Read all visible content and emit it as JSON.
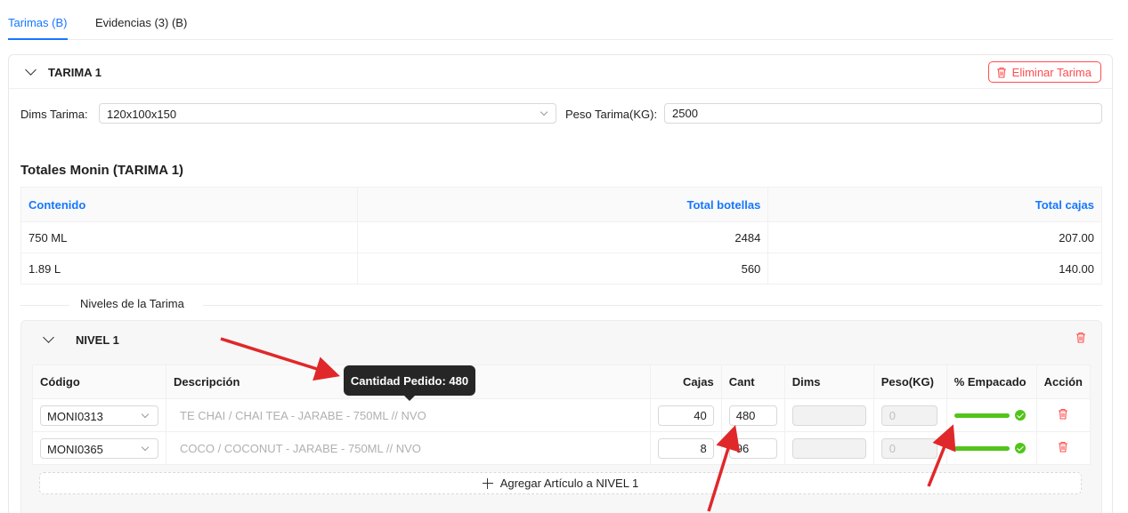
{
  "tabs": [
    {
      "label": "Tarimas (B)",
      "active": true
    },
    {
      "label": "Evidencias (3) (B)",
      "active": false
    }
  ],
  "tarima": {
    "title": "TARIMA 1",
    "delete_label": "Eliminar Tarima",
    "dims_label": "Dims Tarima",
    "dims_value": "120x100x150",
    "peso_label": "Peso Tarima(KG)",
    "peso_value": "2500"
  },
  "totales": {
    "title": "Totales Monin (TARIMA 1)",
    "headers": [
      "Contenido",
      "Total botellas",
      "Total cajas"
    ],
    "rows": [
      [
        "750 ML",
        "2484",
        "207.00"
      ],
      [
        "1.89 L",
        "560",
        "140.00"
      ]
    ]
  },
  "niveles_label": "Niveles de la Tarima",
  "nivel": {
    "title": "NIVEL 1",
    "headers": [
      "Código",
      "Descripción",
      "Cajas",
      "Cant",
      "Dims",
      "Peso(KG)",
      "% Empacado",
      "Acción"
    ],
    "rows": [
      {
        "codigo": "MONI0313",
        "descripcion": "TE CHAI / CHAI TEA - JARABE - 750ML // NVO",
        "cajas": "40",
        "cant": "480",
        "peso": "0",
        "empacado": 1.0
      },
      {
        "codigo": "MONI0365",
        "descripcion": "COCO / COCONUT - JARABE - 750ML // NVO",
        "cajas": "8",
        "cant": "96",
        "peso": "0",
        "empacado": 1.0
      }
    ],
    "add_label": "Agregar Artículo a NIVEL 1"
  },
  "tooltip": "Cantidad Pedido: 480",
  "colors": {
    "accent": "#1677ff",
    "danger": "#ff4d4f",
    "success": "#52c41a",
    "annotation": "#e0282a"
  },
  "icons": [
    "chevron-down-icon",
    "trash-icon",
    "plus-icon",
    "check-circle-icon"
  ]
}
